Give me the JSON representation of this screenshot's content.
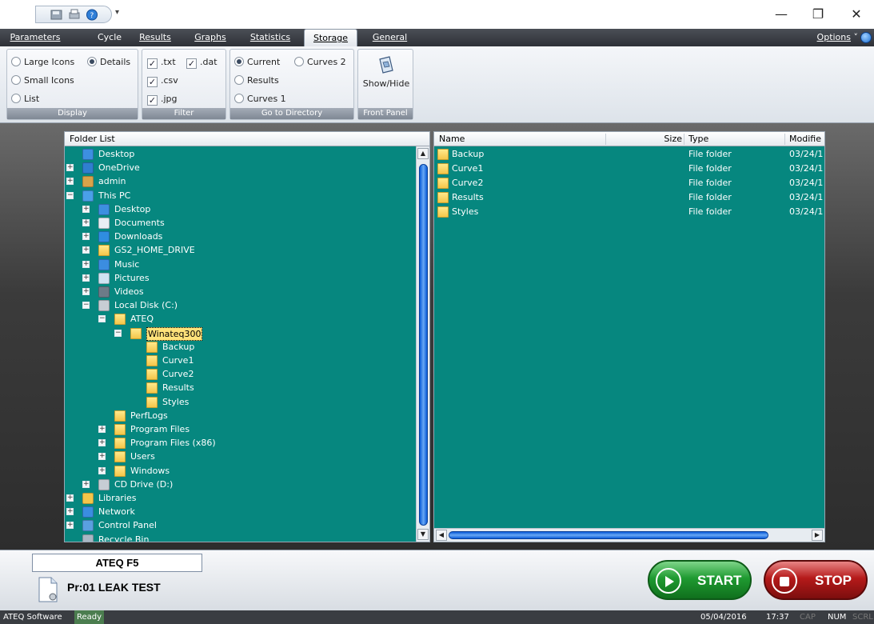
{
  "window": {
    "minimize": "—",
    "restore": "❐",
    "close": "✕"
  },
  "tabs": [
    {
      "label": "Parameters",
      "active": false
    },
    {
      "label": "Cycle",
      "active": false
    },
    {
      "label": "Results",
      "active": false
    },
    {
      "label": "Graphs",
      "active": false
    },
    {
      "label": "Statistics",
      "active": false
    },
    {
      "label": "Storage",
      "active": true
    },
    {
      "label": "General",
      "active": false
    }
  ],
  "options_label": "Options",
  "ribbon": {
    "display": {
      "label": "Display",
      "large_icons": "Large Icons",
      "details": "Details",
      "small_icons": "Small Icons",
      "list": "List",
      "selected": "Details"
    },
    "filter": {
      "label": "Filter",
      "txt": ".txt",
      "dat": ".dat",
      "csv": ".csv",
      "jpg": ".jpg",
      "checked": [
        ".txt",
        ".dat",
        ".csv",
        ".jpg"
      ]
    },
    "goto": {
      "label": "Go to Directory",
      "current": "Current",
      "curves2": "Curves 2",
      "results": "Results",
      "curves1": "Curves 1",
      "selected": "Current"
    },
    "front_panel": {
      "label": "Front Panel",
      "show_hide": "Show/Hide"
    }
  },
  "folder_list": {
    "header": "Folder List",
    "items": [
      {
        "label": "Desktop",
        "depth": 0,
        "icon": "desktop-icon",
        "expander": ""
      },
      {
        "label": "OneDrive",
        "depth": 0,
        "icon": "cloud-icon",
        "expander": "+"
      },
      {
        "label": "admin",
        "depth": 0,
        "icon": "user-icon",
        "expander": "+"
      },
      {
        "label": "This PC",
        "depth": 0,
        "icon": "computer-icon",
        "expander": "−"
      },
      {
        "label": "Desktop",
        "depth": 1,
        "icon": "desktop-icon",
        "expander": "+"
      },
      {
        "label": "Documents",
        "depth": 1,
        "icon": "documents-icon",
        "expander": "+"
      },
      {
        "label": "Downloads",
        "depth": 1,
        "icon": "download-icon",
        "expander": "+"
      },
      {
        "label": "GS2_HOME_DRIVE",
        "depth": 1,
        "icon": "folder-icon",
        "expander": "+"
      },
      {
        "label": "Music",
        "depth": 1,
        "icon": "music-icon",
        "expander": "+"
      },
      {
        "label": "Pictures",
        "depth": 1,
        "icon": "pictures-icon",
        "expander": "+"
      },
      {
        "label": "Videos",
        "depth": 1,
        "icon": "videos-icon",
        "expander": "+"
      },
      {
        "label": "Local Disk (C:)",
        "depth": 1,
        "icon": "drive-icon",
        "expander": "−"
      },
      {
        "label": "ATEQ",
        "depth": 2,
        "icon": "folder-icon",
        "expander": "−"
      },
      {
        "label": "Winateq300",
        "depth": 3,
        "icon": "folder-icon",
        "expander": "−",
        "selected": true
      },
      {
        "label": "Backup",
        "depth": 4,
        "icon": "folder-icon",
        "expander": ""
      },
      {
        "label": "Curve1",
        "depth": 4,
        "icon": "folder-icon",
        "expander": ""
      },
      {
        "label": "Curve2",
        "depth": 4,
        "icon": "folder-icon",
        "expander": ""
      },
      {
        "label": "Results",
        "depth": 4,
        "icon": "folder-icon",
        "expander": ""
      },
      {
        "label": "Styles",
        "depth": 4,
        "icon": "folder-icon",
        "expander": ""
      },
      {
        "label": "PerfLogs",
        "depth": 2,
        "icon": "folder-icon",
        "expander": ""
      },
      {
        "label": "Program Files",
        "depth": 2,
        "icon": "folder-icon",
        "expander": "+"
      },
      {
        "label": "Program Files (x86)",
        "depth": 2,
        "icon": "folder-icon",
        "expander": "+"
      },
      {
        "label": "Users",
        "depth": 2,
        "icon": "folder-icon",
        "expander": "+"
      },
      {
        "label": "Windows",
        "depth": 2,
        "icon": "folder-icon",
        "expander": "+"
      },
      {
        "label": "CD Drive (D:)",
        "depth": 1,
        "icon": "cd-drive-icon",
        "expander": "+"
      },
      {
        "label": "Libraries",
        "depth": 0,
        "icon": "libraries-icon",
        "expander": "+"
      },
      {
        "label": "Network",
        "depth": 0,
        "icon": "network-icon",
        "expander": "+"
      },
      {
        "label": "Control Panel",
        "depth": 0,
        "icon": "control-panel-icon",
        "expander": "+"
      },
      {
        "label": "Recycle Bin",
        "depth": 0,
        "icon": "recycle-bin-icon",
        "expander": ""
      }
    ]
  },
  "file_list": {
    "columns": {
      "name": "Name",
      "size": "Size",
      "type": "Type",
      "modified": "Modifie"
    },
    "rows": [
      {
        "name": "Backup",
        "size": "",
        "type": "File folder",
        "modified": "03/24/1"
      },
      {
        "name": "Curve1",
        "size": "",
        "type": "File folder",
        "modified": "03/24/1"
      },
      {
        "name": "Curve2",
        "size": "",
        "type": "File folder",
        "modified": "03/24/1"
      },
      {
        "name": "Results",
        "size": "",
        "type": "File folder",
        "modified": "03/24/1"
      },
      {
        "name": "Styles",
        "size": "",
        "type": "File folder",
        "modified": "03/24/1"
      }
    ]
  },
  "bottom": {
    "machine": "ATEQ F5",
    "program": "Pr:01  LEAK TEST",
    "start": "START",
    "stop": "STOP"
  },
  "status": {
    "app": "ATEQ Software",
    "state": "Ready",
    "date": "05/04/2016",
    "time": "17:37",
    "cap": "CAP",
    "num": "NUM",
    "scrl": "SCRL"
  },
  "colors": {
    "pane_bg": "#06877f",
    "start": "#1f9a31",
    "stop": "#b51a1a"
  }
}
